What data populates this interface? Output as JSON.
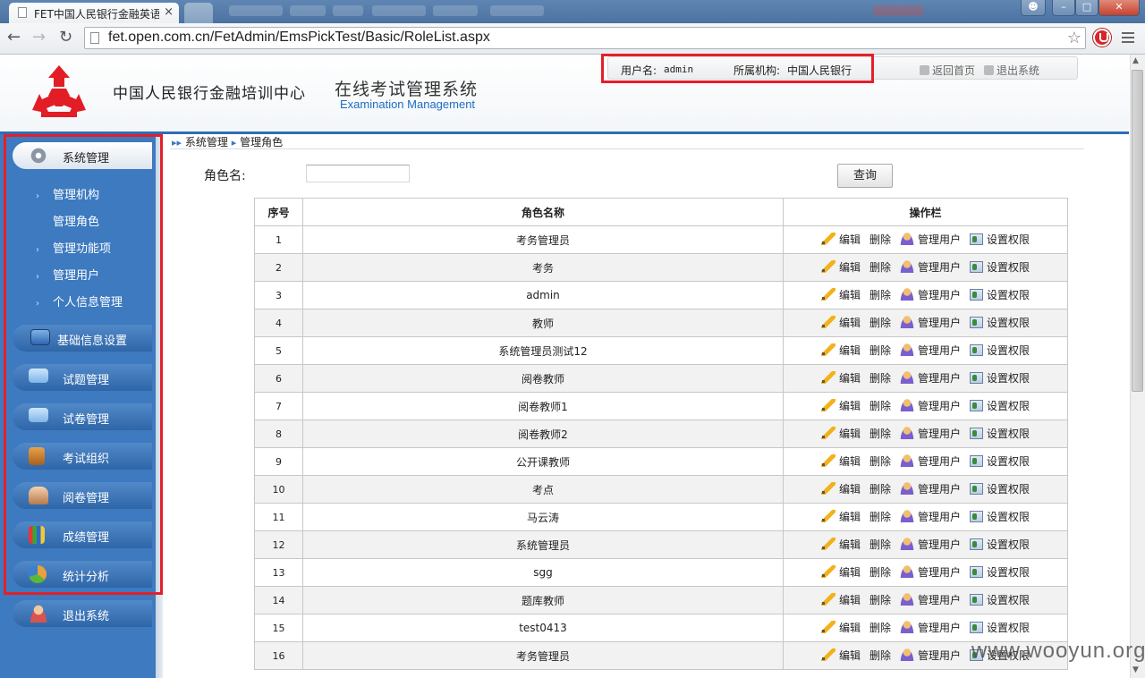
{
  "browser": {
    "tab_title": "FET中国人民银行金融英语",
    "tab_close": "×",
    "url": "fet.open.com.cn/FetAdmin/EmsPickTest/Basic/RoleList.aspx"
  },
  "header": {
    "org_name": "中国人民银行金融培训中心",
    "system_title": "在线考试管理系统",
    "system_subtitle": "Examination Management",
    "user_label": "用户名:",
    "user_value": "admin",
    "org_label": "所属机构:",
    "org_value": "中国人民银行",
    "home_link": "返回首页",
    "logout_link": "退出系统"
  },
  "sidebar": {
    "categories": [
      {
        "label": "系统管理",
        "icon": "gear-icon"
      },
      {
        "label": "基础信息设置",
        "icon": "monitor-icon"
      },
      {
        "label": "试题管理",
        "icon": "folder-icon"
      },
      {
        "label": "试卷管理",
        "icon": "folder-icon"
      },
      {
        "label": "考试组织",
        "icon": "cabinet-icon"
      },
      {
        "label": "阅卷管理",
        "icon": "inbox-icon"
      },
      {
        "label": "成绩管理",
        "icon": "books-icon"
      },
      {
        "label": "统计分析",
        "icon": "pie-chart-icon"
      },
      {
        "label": "退出系统",
        "icon": "user-exit-icon"
      }
    ],
    "sub_items": [
      {
        "label": "管理机构"
      },
      {
        "label": "管理角色"
      },
      {
        "label": "管理功能项"
      },
      {
        "label": "管理用户"
      },
      {
        "label": "个人信息管理"
      }
    ]
  },
  "breadcrumb": {
    "level1": "系统管理",
    "level2": "管理角色"
  },
  "search": {
    "label": "角色名:",
    "value": "",
    "button": "查询"
  },
  "table": {
    "columns": [
      "序号",
      "角色名称",
      "操作栏"
    ],
    "actions": [
      "编辑",
      "删除",
      "管理用户",
      "设置权限"
    ],
    "rows": [
      {
        "no": "1",
        "name": "考务管理员"
      },
      {
        "no": "2",
        "name": "考务"
      },
      {
        "no": "3",
        "name": "admin"
      },
      {
        "no": "4",
        "name": "教师"
      },
      {
        "no": "5",
        "name": "系统管理员测试12"
      },
      {
        "no": "6",
        "name": "阅卷教师"
      },
      {
        "no": "7",
        "name": "阅卷教师1"
      },
      {
        "no": "8",
        "name": "阅卷教师2"
      },
      {
        "no": "9",
        "name": "公开课教师"
      },
      {
        "no": "10",
        "name": "考点"
      },
      {
        "no": "11",
        "name": "马云涛"
      },
      {
        "no": "12",
        "name": "系统管理员"
      },
      {
        "no": "13",
        "name": "sgg"
      },
      {
        "no": "14",
        "name": "题库教师"
      },
      {
        "no": "15",
        "name": "test0413"
      },
      {
        "no": "16",
        "name": "考务管理员"
      }
    ]
  },
  "watermark": "www.wooyun.org",
  "colors": {
    "accent": "#3d7ac0",
    "highlight_border": "#e3202a",
    "subtitle": "#1f6cc2"
  }
}
